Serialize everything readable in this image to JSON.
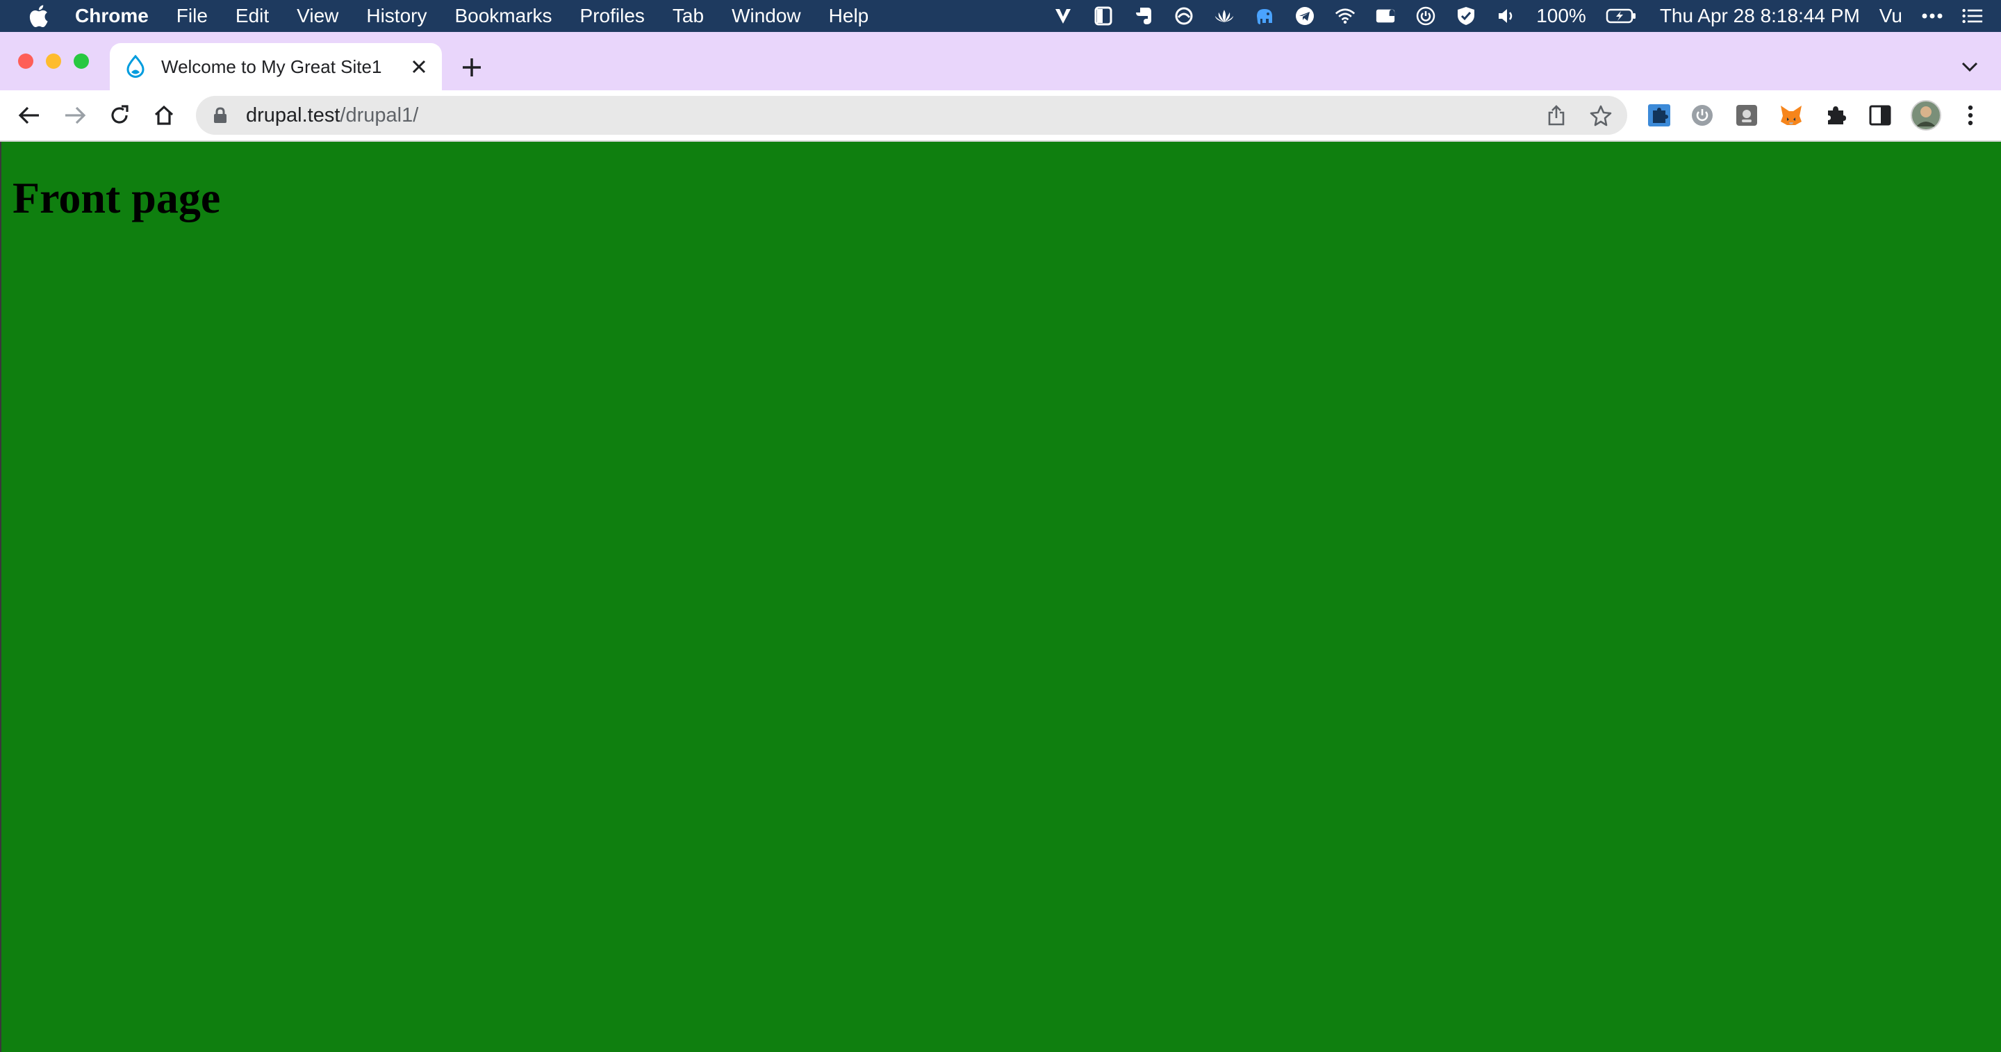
{
  "menubar": {
    "app_name": "Chrome",
    "items": [
      "File",
      "Edit",
      "View",
      "History",
      "Bookmarks",
      "Profiles",
      "Tab",
      "Window",
      "Help"
    ],
    "battery": "100%",
    "datetime": "Thu Apr 28  8:18:44 PM",
    "user": "Vu"
  },
  "tabs": [
    {
      "title": "Welcome to My Great Site1",
      "active": true
    }
  ],
  "omnibox": {
    "host": "drupal.test",
    "path": "/drupal1/"
  },
  "page": {
    "heading": "Front page",
    "background": "#0f7f0f"
  },
  "colors": {
    "menubar": "#1e3a5f",
    "tabstrip": "#e9d6fb",
    "drupal_blue": "#009cde"
  }
}
